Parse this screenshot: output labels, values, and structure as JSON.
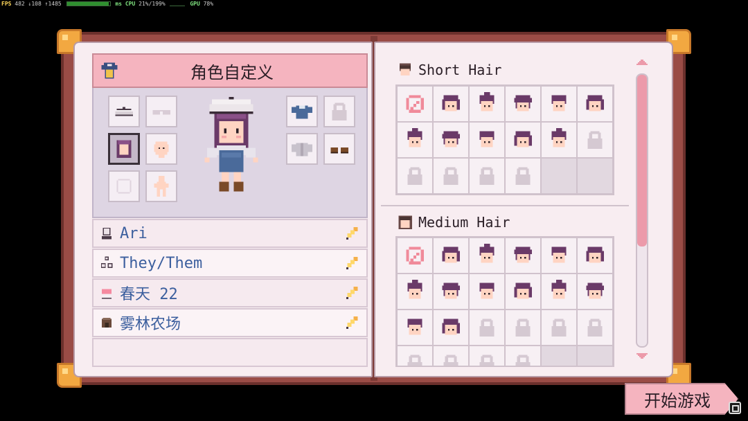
{
  "hud": {
    "fps_label": "FPS",
    "fps_values": "482 ↓108 ↑1485",
    "fps_bar_fill": 0.97,
    "ms_label": "ms",
    "cpu_label": "CPU",
    "cpu_value": "21%/199%",
    "gpu_label": "GPU",
    "gpu_value": "78%"
  },
  "left_page": {
    "title": "角色自定义",
    "title_icon": "shirt-icon",
    "left_slots": [
      {
        "name": "hat-slot",
        "icon": "beret-icon",
        "selected": false,
        "dim": false
      },
      {
        "name": "glasses-slot",
        "icon": "glasses-icon",
        "selected": false,
        "dim": true
      },
      {
        "name": "hair-slot",
        "icon": "hair-icon",
        "selected": true,
        "dim": false
      },
      {
        "name": "head-slot",
        "icon": "bald-head-icon",
        "selected": false,
        "dim": false
      },
      {
        "name": "face-slot",
        "icon": "face-outline-icon",
        "selected": false,
        "dim": true
      },
      {
        "name": "body-slot",
        "icon": "body-icon",
        "selected": false,
        "dim": false
      }
    ],
    "right_slots": [
      {
        "name": "top-slot",
        "icon": "shirt-icon",
        "selected": false,
        "dim": false
      },
      {
        "name": "locked-slot",
        "icon": "lock-icon",
        "selected": false,
        "dim": true
      },
      {
        "name": "outer-slot",
        "icon": "jacket-icon",
        "selected": false,
        "dim": true
      },
      {
        "name": "shoes-slot",
        "icon": "shoes-icon",
        "selected": false,
        "dim": false
      }
    ],
    "info": [
      {
        "icon": "name-icon",
        "text": "Ari"
      },
      {
        "icon": "pronoun-icon",
        "text": "They/Them"
      },
      {
        "icon": "cake-icon",
        "text": "春天 22"
      },
      {
        "icon": "farm-icon",
        "text": "雾林农场"
      }
    ]
  },
  "right_page": {
    "sections": [
      {
        "title": "Short Hair",
        "icon": "short-hair-icon",
        "cells": [
          "none",
          "hair",
          "hair",
          "hair",
          "hair",
          "hair",
          "hair",
          "hair",
          "hair",
          "hair",
          "hair",
          "lock",
          "lock",
          "lock",
          "lock",
          "lock",
          "empty",
          "empty"
        ]
      },
      {
        "title": "Medium Hair",
        "icon": "medium-hair-icon",
        "cells": [
          "none",
          "hair",
          "hair",
          "hair",
          "hair",
          "hair",
          "hair",
          "hair",
          "hair",
          "hair",
          "hair",
          "hair",
          "hair",
          "hair",
          "lock",
          "lock",
          "lock",
          "lock",
          "lock",
          "lock",
          "lock",
          "lock",
          "empty",
          "empty"
        ]
      }
    ]
  },
  "start_button": {
    "label": "开始游戏"
  },
  "colors": {
    "hair": "#6a3a68",
    "skin": "#ffd4c2",
    "lock": "#d5c9d2",
    "none": "#f08a9a",
    "accent": "#f5b4bf",
    "info_text": "#3c5f9e"
  }
}
